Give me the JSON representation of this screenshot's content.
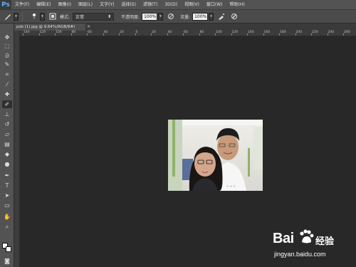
{
  "app": {
    "logo": "Ps"
  },
  "menu": [
    "文件(F)",
    "编辑(E)",
    "图像(I)",
    "图层(L)",
    "文字(Y)",
    "选择(S)",
    "滤镜(T)",
    "3D(D)",
    "视图(V)",
    "窗口(W)",
    "帮助(H)"
  ],
  "options": {
    "brush_size": "1",
    "mode_label": "模式:",
    "mode_value": "正常",
    "opacity_label": "不透明度:",
    "opacity_value": "100%",
    "flow_label": "流量:",
    "flow_value": "100%"
  },
  "document": {
    "tab_title": "psb (1).jpg @ 9.64%(RGB/8#)",
    "close": "×"
  },
  "ruler": {
    "ticks": [
      "140",
      "120",
      "100",
      "80",
      "60",
      "40",
      "20",
      "0",
      "20",
      "40",
      "60",
      "80",
      "100",
      "120",
      "140",
      "160",
      "180",
      "200",
      "220",
      "240",
      "260"
    ]
  },
  "tools": [
    {
      "name": "move-tool-icon",
      "glyph": "✥"
    },
    {
      "name": "marquee-tool-icon",
      "glyph": "⬚"
    },
    {
      "name": "lasso-tool-icon",
      "glyph": "ᘐ"
    },
    {
      "name": "quick-select-tool-icon",
      "glyph": "✎"
    },
    {
      "name": "crop-tool-icon",
      "glyph": "⌗"
    },
    {
      "name": "eyedropper-tool-icon",
      "glyph": "⁄"
    },
    {
      "name": "healing-brush-tool-icon",
      "glyph": "✚"
    },
    {
      "name": "brush-tool-icon",
      "glyph": "✐"
    },
    {
      "name": "clone-stamp-tool-icon",
      "glyph": "⊥"
    },
    {
      "name": "history-brush-tool-icon",
      "glyph": "↺"
    },
    {
      "name": "eraser-tool-icon",
      "glyph": "▱"
    },
    {
      "name": "gradient-tool-icon",
      "glyph": "▤"
    },
    {
      "name": "blur-tool-icon",
      "glyph": "◆"
    },
    {
      "name": "dodge-tool-icon",
      "glyph": "●"
    },
    {
      "name": "pen-tool-icon",
      "glyph": "✒"
    },
    {
      "name": "type-tool-icon",
      "glyph": "T"
    },
    {
      "name": "path-select-tool-icon",
      "glyph": "➤"
    },
    {
      "name": "shape-tool-icon",
      "glyph": "▭"
    },
    {
      "name": "hand-tool-icon",
      "glyph": "✋"
    },
    {
      "name": "zoom-tool-icon",
      "glyph": "⌕"
    }
  ],
  "active_tool_index": 7,
  "colors": {
    "foreground": "#ffffff",
    "background": "#ffffff"
  },
  "watermark": {
    "logo_left": "Bai",
    "logo_right": "经验",
    "url": "jingyan.baidu.com"
  }
}
